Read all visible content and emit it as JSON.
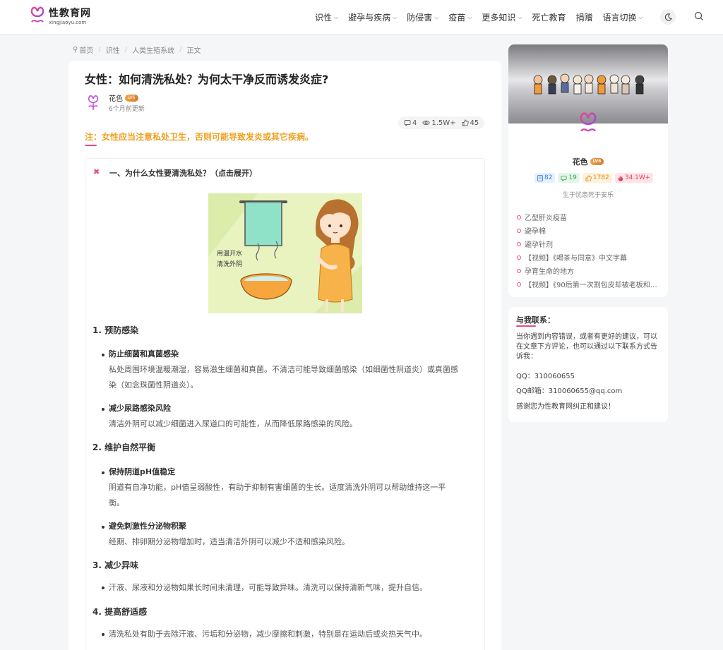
{
  "header": {
    "logo_cn": "性教育网",
    "logo_en": "xingjiaoyu.com",
    "nav": [
      {
        "label": "识性",
        "caret": true
      },
      {
        "label": "避孕与疾病",
        "caret": true
      },
      {
        "label": "防侵害",
        "caret": true
      },
      {
        "label": "疫苗",
        "caret": true
      },
      {
        "label": "更多知识",
        "caret": true
      },
      {
        "label": "死亡教育",
        "caret": false
      },
      {
        "label": "捐赠",
        "caret": false
      },
      {
        "label": "语言切换",
        "caret": true
      }
    ]
  },
  "breadcrumb": [
    "首页",
    "识性",
    "人类生殖系统",
    "正文"
  ],
  "article": {
    "title": "女性：如何清洗私处？为何太干净反而诱发炎症?",
    "author": "花色",
    "level": "LV6",
    "updated": "6个月前更新",
    "stats": {
      "comments": "4",
      "views": "1.5W+",
      "likes": "45"
    },
    "note": "注：女性应当注意私处卫生，否则可能导致发炎或其它疾病。",
    "collapse_title": "一、为什么女性要清洗私处？（点击展开）",
    "illustration_text": [
      "用温开水",
      "清洗外阴"
    ],
    "sections": [
      {
        "heading": "1. 预防感染",
        "items": [
          {
            "title": "防止细菌和真菌感染",
            "text": [
              "私处周围环境温暖潮湿，容易滋生细菌和真菌。不清洁可能导致细菌感染（如细菌性阴道炎）或真菌感",
              "染（如念珠菌性阴道炎）。"
            ]
          },
          {
            "title": "减少尿路感染风险",
            "text": [
              "清洁外阴可以减少细菌进入尿道口的可能性，从而降低尿路感染的风险。"
            ]
          }
        ]
      },
      {
        "heading": "2. 维护自然平衡",
        "items": [
          {
            "title": "保持阴道pH值稳定",
            "text": [
              "阴道有自净功能，pH值呈弱酸性，有助于抑制有害细菌的生长。适度清洗外阴可以帮助维持这一平",
              "衡。"
            ]
          },
          {
            "title": "避免刺激性分泌物积聚",
            "text": [
              "经期、排卵期分泌物增加时，适当清洁外阴可以减少不适和感染风险。"
            ]
          }
        ]
      },
      {
        "heading": "3. 减少异味",
        "items": [
          {
            "title": "",
            "text": [
              "汗液、尿液和分泌物如果长时间未清理，可能导致异味。清洗可以保持清新气味，提升自信。"
            ]
          }
        ]
      },
      {
        "heading": "4. 提高舒适感",
        "items": [
          {
            "title": "",
            "text": [
              "清洗私处有助于去除汗液、污垢和分泌物，减少摩擦和刺激，特别是在运动后或炎热天气中。"
            ]
          }
        ]
      }
    ]
  },
  "sidebar": {
    "name": "花色",
    "level": "LV6",
    "counts": {
      "posts": "82",
      "comments": "19",
      "likes": "1782",
      "heat": "34.1W+"
    },
    "motto": "生于忧患死于安乐",
    "links": [
      "乙型肝炎疫苗",
      "避孕棉",
      "避孕针剂",
      "【视频】《喝茶与同意》中文字幕",
      "孕育生命的地方",
      "【视频】《90后第一次割包皮却被老板和…"
    ],
    "contact": {
      "title": "与我联系：",
      "intro": "当你遇到内容错误，或者有更好的建议，可以在文章下方评论，也可以通过以下联系方式告诉我：",
      "qq": "QQ：310060655",
      "email": "QQ邮箱：310060655@qq.com",
      "thanks": "感谢您为性教育网纠正和建议！"
    }
  },
  "colors": {
    "accent": "#e84a8a",
    "note": "#f0a020",
    "logo_purple": "#b04ae0"
  }
}
